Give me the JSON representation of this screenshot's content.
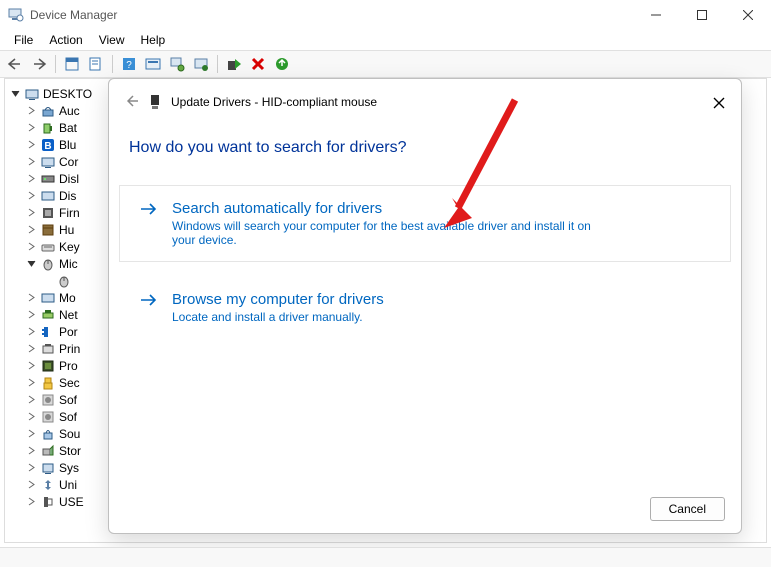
{
  "window": {
    "title": "Device Manager",
    "menus": [
      "File",
      "Action",
      "View",
      "Help"
    ],
    "root_node": "DESKTO",
    "tree": [
      {
        "label": "Auc"
      },
      {
        "label": "Bat"
      },
      {
        "label": "Blu"
      },
      {
        "label": "Cor"
      },
      {
        "label": "Disl"
      },
      {
        "label": "Dis"
      },
      {
        "label": "Firn"
      },
      {
        "label": "Hu"
      },
      {
        "label": "Key"
      },
      {
        "label": "Mic",
        "expanded": true,
        "child": ""
      },
      {
        "label": "Mo"
      },
      {
        "label": "Net"
      },
      {
        "label": "Por"
      },
      {
        "label": "Prin"
      },
      {
        "label": "Pro"
      },
      {
        "label": "Sec"
      },
      {
        "label": "Sof"
      },
      {
        "label": "Sof"
      },
      {
        "label": "Sou"
      },
      {
        "label": "Stor"
      },
      {
        "label": "Sys"
      },
      {
        "label": "Uni"
      },
      {
        "label": "USE"
      }
    ]
  },
  "dialog": {
    "title": "Update Drivers - HID-compliant mouse",
    "question": "How do you want to search for drivers?",
    "opt1_title": "Search automatically for drivers",
    "opt1_desc": "Windows will search your computer for the best available driver and install it on your device.",
    "opt2_title": "Browse my computer for drivers",
    "opt2_desc": "Locate and install a driver manually.",
    "cancel": "Cancel"
  }
}
